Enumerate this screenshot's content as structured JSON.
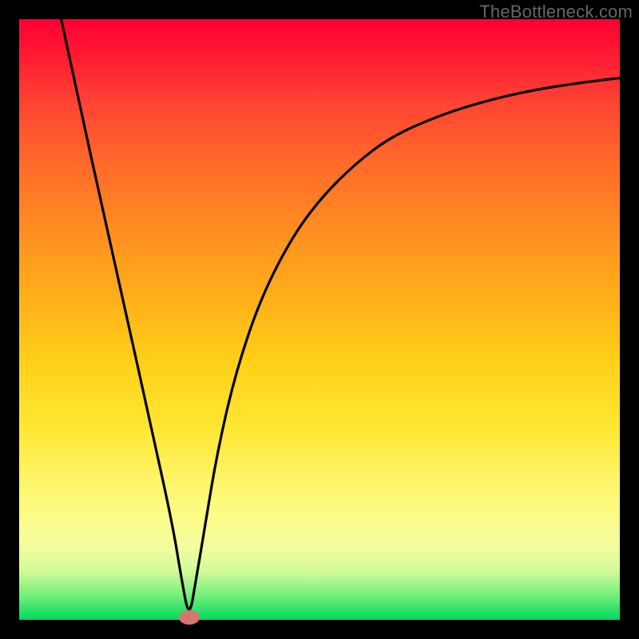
{
  "watermark": "TheBottleneck.com",
  "chart_data": {
    "type": "line",
    "title": "",
    "xlabel": "",
    "ylabel": "",
    "xlim": [
      0,
      100
    ],
    "ylim": [
      0,
      100
    ],
    "grid": false,
    "legend": false,
    "background_gradient": {
      "top": "#ff0033",
      "mid": "#ffd21a",
      "bottom": "#00d860"
    },
    "marker": {
      "x_pct": 28.3,
      "y_pct": 0,
      "color": "#d7766d"
    },
    "series": [
      {
        "name": "curve",
        "x_pct": [
          7,
          10,
          14,
          18,
          22,
          25.5,
          27,
          28.3,
          29.5,
          31,
          33,
          36,
          40,
          45,
          50,
          56,
          62,
          70,
          78,
          86,
          94,
          100
        ],
        "y_pct": [
          100,
          86,
          68,
          50,
          32,
          16,
          7,
          0,
          7,
          16,
          28,
          41,
          53,
          63,
          70,
          76,
          80.5,
          84,
          86.5,
          88.3,
          89.5,
          90.2
        ]
      }
    ]
  }
}
